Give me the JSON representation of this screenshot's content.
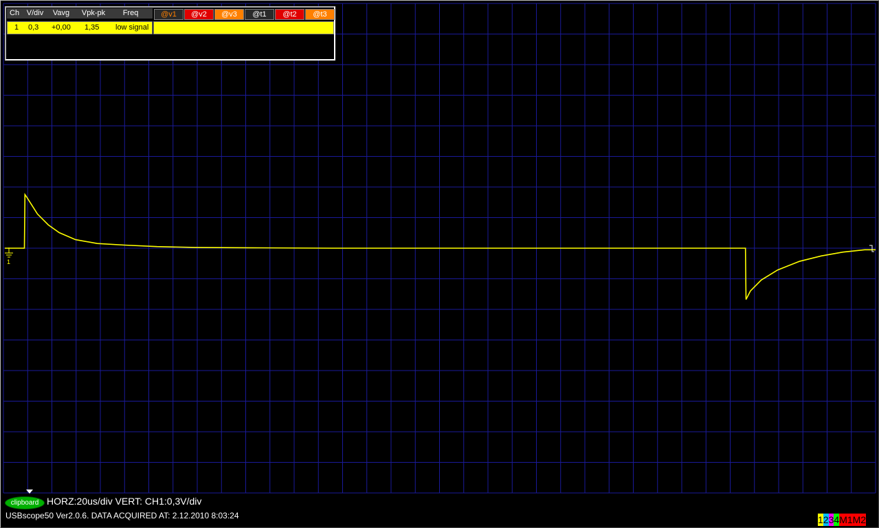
{
  "app": {
    "name": "USBscope50",
    "footer_text": "USBscope50 Ver2.0.6.  DATA ACQUIRED AT: 2.12.2010 8:03:24",
    "settings_text": "HORZ:20us/div VERT: CH1:0,3V/div"
  },
  "colors": {
    "background": "#000000",
    "grid": "#1a1a9a",
    "trace": "#ffff00",
    "panel_border": "#b0b0b0"
  },
  "measurement_panel": {
    "headers": [
      "Ch",
      "V/div",
      "Vavg",
      "Vpk-pk",
      "Freq"
    ],
    "cursor_buttons": [
      {
        "label": "@v1",
        "color": "#ff8000",
        "bg": "#2a2a2a"
      },
      {
        "label": "@v2",
        "color": "#ffffff",
        "bg": "#e00000"
      },
      {
        "label": "@v3",
        "color": "#ffffff",
        "bg": "#ff8000"
      },
      {
        "label": "@t1",
        "color": "#ffffff",
        "bg": "#2a2a2a"
      },
      {
        "label": "@t2",
        "color": "#ffffff",
        "bg": "#e00000"
      },
      {
        "label": "@t3",
        "color": "#ffffff",
        "bg": "#ff8000"
      }
    ],
    "rows": [
      {
        "ch": "1",
        "vdiv": "0,3",
        "vavg": "+0,00",
        "vpkpk": "1,35",
        "freq": "low signal"
      }
    ]
  },
  "clipboard_button": {
    "label": "clipboard"
  },
  "channel_buttons": [
    {
      "label": "1",
      "bg": "#ffff00",
      "fg": "#000000"
    },
    {
      "label": "2",
      "bg": "#00c0ff",
      "fg": "#000000"
    },
    {
      "label": "3",
      "bg": "#ff00ff",
      "fg": "#000000"
    },
    {
      "label": "4",
      "bg": "#00ff00",
      "fg": "#000000"
    },
    {
      "label": "M1",
      "bg": "#ff0000",
      "fg": "#000000"
    },
    {
      "label": "M2",
      "bg": "#ff0000",
      "fg": "#000000"
    }
  ],
  "ground_marker_label": "1",
  "chart_data": {
    "type": "line",
    "title": "",
    "xlabel": "",
    "ylabel": "",
    "horizontal_scale": "20us/div",
    "vertical_scale": "0,3V/div",
    "grid": true,
    "x_unit": "us",
    "y_unit": "V",
    "xlim": [
      0,
      1600
    ],
    "ylim": [
      -1.5,
      1.5
    ],
    "series": [
      {
        "channel": "1",
        "color": "#ffff00",
        "x": [
          0,
          36,
          37,
          40,
          50,
          60,
          80,
          100,
          130,
          170,
          220,
          280,
          350,
          450,
          600,
          800,
          1000,
          1200,
          1350,
          1361,
          1362,
          1370,
          1390,
          1420,
          1460,
          1500,
          1540,
          1580,
          1600
        ],
        "y": [
          0,
          0,
          0.69,
          0.66,
          0.55,
          0.44,
          0.3,
          0.2,
          0.11,
          0.06,
          0.04,
          0.02,
          0.01,
          0.005,
          0,
          0,
          0,
          0,
          0,
          0,
          -0.66,
          -0.55,
          -0.41,
          -0.28,
          -0.17,
          -0.1,
          -0.05,
          -0.02,
          -0.02
        ]
      }
    ]
  }
}
